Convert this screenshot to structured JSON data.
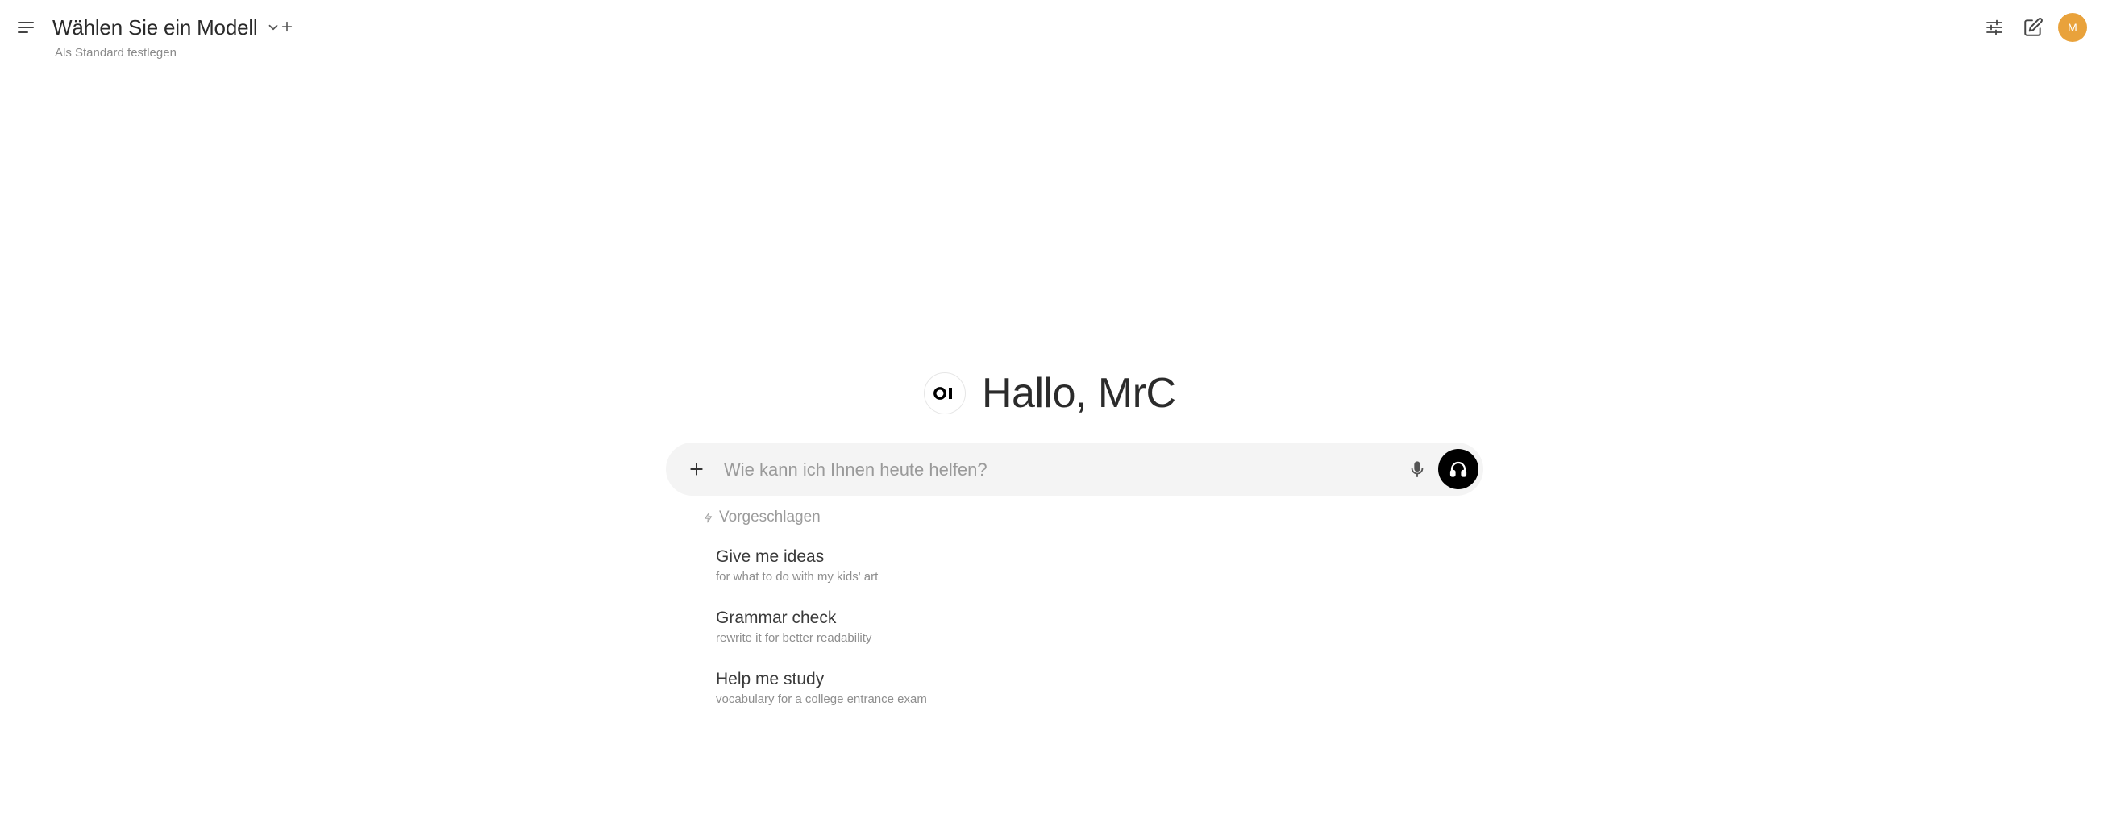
{
  "header": {
    "model_title": "Wählen Sie ein Modell",
    "set_default_label": "Als Standard festlegen",
    "avatar_initial": "M"
  },
  "greeting": {
    "logo_text": "OI",
    "text": "Hallo, MrC"
  },
  "input": {
    "placeholder": "Wie kann ich Ihnen heute helfen?",
    "value": ""
  },
  "suggestions": {
    "header": "Vorgeschlagen",
    "items": [
      {
        "title": "Give me ideas",
        "subtitle": "for what to do with my kids' art"
      },
      {
        "title": "Grammar check",
        "subtitle": "rewrite it for better readability"
      },
      {
        "title": "Help me study",
        "subtitle": "vocabulary for a college entrance exam"
      }
    ]
  },
  "icons": {
    "menu": "hamburger-menu-icon",
    "model_dropdown": "chevron-down-icon",
    "add_model": "plus-icon",
    "controls": "sliders-icon",
    "new_chat": "pencil-square-icon",
    "input_plus": "plus-icon",
    "mic": "microphone-icon",
    "voice_mode": "headphones-icon",
    "suggested": "sparkle-icon"
  },
  "colors": {
    "avatar_bg": "#e9a23b",
    "input_bg": "#f4f4f4",
    "voice_btn_bg": "#000000"
  }
}
